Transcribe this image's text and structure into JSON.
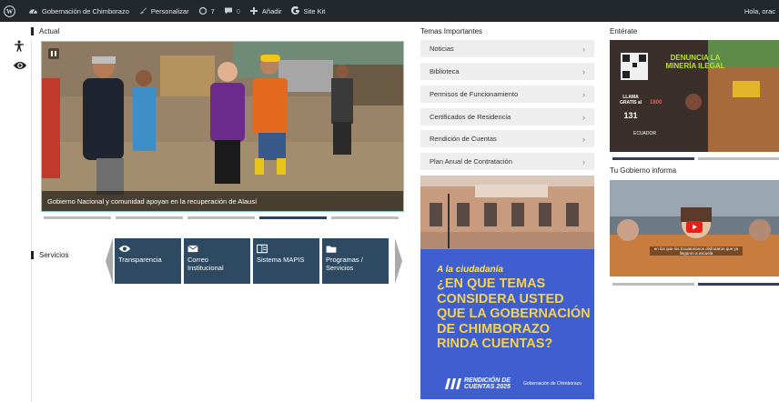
{
  "adminbar": {
    "site_name": "Gobernación de Chimborazo",
    "customize": "Personalizar",
    "updates_count": "7",
    "comments_count": "0",
    "add_new": "Añadir",
    "sitekit": "Site Kit",
    "greeting": "Hola, orac"
  },
  "actual": {
    "heading": "Actual",
    "slide_caption": "Gobierno Nacional y comunidad apoyan en la recuperación de Alausí",
    "slide_count": 5,
    "active_slide": 4
  },
  "servicios": {
    "heading": "Servicios",
    "items": [
      {
        "label_1": "Transparencia",
        "label_2": "",
        "icon": "eye-icon"
      },
      {
        "label_1": "Correo",
        "label_2": "Institucional",
        "icon": "mail-icon"
      },
      {
        "label_1": "Sistema MAPIS",
        "label_2": "",
        "icon": "document-icon"
      },
      {
        "label_1": "Programas /",
        "label_2": "Servicios",
        "icon": "folder-icon"
      }
    ]
  },
  "temas": {
    "heading": "Temas Importantes",
    "items": [
      "Noticias",
      "Biblioteca",
      "Permisos de Funcionamiento",
      "Certificados de Residencia",
      "Rendición de Cuentas",
      "Plan Anual de Contratación"
    ]
  },
  "ciudadania": {
    "lead": "A la ciudadanía",
    "question": "¿EN QUE TEMAS CONSIDERA USTED QUE LA GOBERNACIÓN DE CHIMBORAZO RINDA CUENTAS?",
    "footer_title_1": "RENDICIÓN DE",
    "footer_title_2": "CUENTAS 2025",
    "footer_org": "Gobernación de Chimborazo"
  },
  "enterate": {
    "heading": "Entérate",
    "banner_title": "DENUNCIA LA MINERÍA ILEGAL",
    "call_label": "LLAMA GRATIS al",
    "call_number": "131",
    "phone_label": "1800",
    "logo_text": "ECUADOR",
    "active_slide": 1
  },
  "tu_gobierno": {
    "heading": "Tu Gobierno informa",
    "video_subtitle": "en los que los Ecuatorianos disfrutaron que ya llegaron a escuela",
    "active_slide": 2
  },
  "colors": {
    "adminbar": "#23282d",
    "service_card": "#2d4a62",
    "active_dot": "#2e3f63",
    "banner_blue": "#3f5fd0",
    "banner_yellow": "#f4d24b"
  }
}
